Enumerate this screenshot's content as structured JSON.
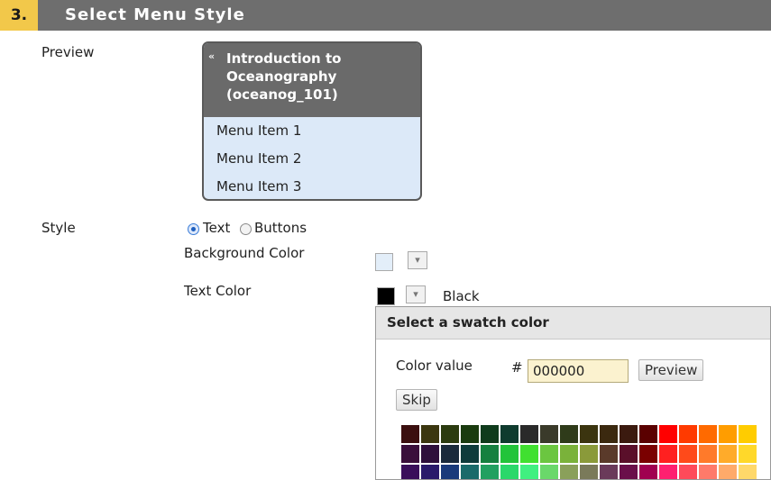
{
  "section": {
    "number": "3.",
    "title": "Select Menu Style"
  },
  "preview": {
    "label": "Preview",
    "caret": "«",
    "menu_title_lines": [
      "Introduction to",
      "Oceanography",
      "(oceanog_101)"
    ],
    "menu_items": [
      "Menu Item 1",
      "Menu Item 2",
      "Menu Item 3"
    ]
  },
  "style": {
    "label": "Style",
    "options": [
      {
        "label": "Text",
        "checked": true
      },
      {
        "label": "Buttons",
        "checked": false
      }
    ]
  },
  "background_color": {
    "label": "Background Color",
    "value": "#e3eef9"
  },
  "text_color": {
    "label": "Text Color",
    "value": "#000000",
    "name": "Black"
  },
  "popup": {
    "title": "Select a swatch color",
    "color_value_label": "Color value",
    "hash": "#",
    "color_value": "000000",
    "preview_button": "Preview",
    "skip_button": "Skip"
  },
  "palette": [
    [
      "#3b0f0f",
      "#3b360f",
      "#2b3b0f",
      "#1a3b0f",
      "#0f3b1c",
      "#0f3b2e",
      "#2a2a2a",
      "#3a3a2a",
      "#2f3b1a",
      "#3b340f",
      "#3b290f",
      "#3b1a0f",
      "#5a0000",
      "#ff0000",
      "#ff3a00",
      "#ff6a00",
      "#ff9d00",
      "#ffcc00"
    ],
    [
      "#3a0f3b",
      "#2e0f3b",
      "#1a2a3b",
      "#0f3b3b",
      "#15803f",
      "#22c43a",
      "#40e030",
      "#6bc640",
      "#7ab23a",
      "#8a9a3a",
      "#5a3a2a",
      "#5a0f2a",
      "#7a0000",
      "#ff2020",
      "#ff4a1a",
      "#ff7a2a",
      "#ffab2a",
      "#ffd82a"
    ],
    [
      "#3a0f5a",
      "#2a1a6a",
      "#1a3a7a",
      "#1a6a6a",
      "#22a060",
      "#2ad86a",
      "#40f080",
      "#6ad86a",
      "#8aa05a",
      "#7a7a5a",
      "#6a3a5a",
      "#6a0f4a",
      "#a00050",
      "#ff2070",
      "#ff4a5a",
      "#ff7a6a",
      "#ffaa6a",
      "#ffd86a"
    ]
  ]
}
